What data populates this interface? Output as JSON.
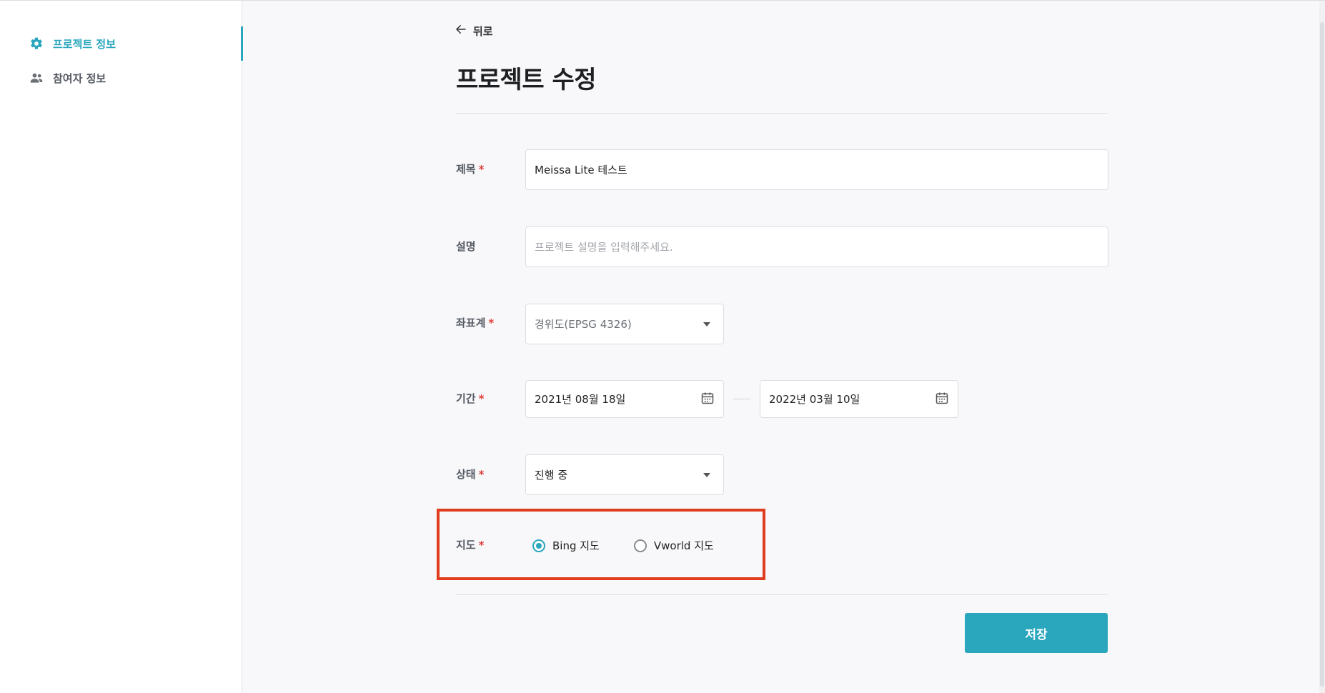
{
  "sidebar": {
    "items": [
      {
        "label": "프로젝트 정보",
        "icon": "gear-icon",
        "active": true
      },
      {
        "label": "참여자 정보",
        "icon": "people-icon",
        "active": false
      }
    ]
  },
  "header": {
    "back_label": "뒤로",
    "title": "프로젝트 수정"
  },
  "form": {
    "title": {
      "label": "제목",
      "required": "*",
      "value": "Meissa Lite 테스트"
    },
    "description": {
      "label": "설명",
      "placeholder": "프로젝트 설명을 입력해주세요."
    },
    "crs": {
      "label": "좌표계",
      "required": "*",
      "value": "경위도(EPSG 4326)"
    },
    "period": {
      "label": "기간",
      "required": "*",
      "start": "2021년 08월 18일",
      "end": "2022년 03월 10일"
    },
    "status": {
      "label": "상태",
      "required": "*",
      "value": "진행 중"
    },
    "map": {
      "label": "지도",
      "required": "*",
      "options": [
        {
          "label": "Bing 지도",
          "checked": true
        },
        {
          "label": "Vworld 지도",
          "checked": false
        }
      ]
    }
  },
  "actions": {
    "save_label": "저장"
  },
  "colors": {
    "accent": "#2aa6bd",
    "required": "#e1403a",
    "highlight": "#e03c1e"
  }
}
